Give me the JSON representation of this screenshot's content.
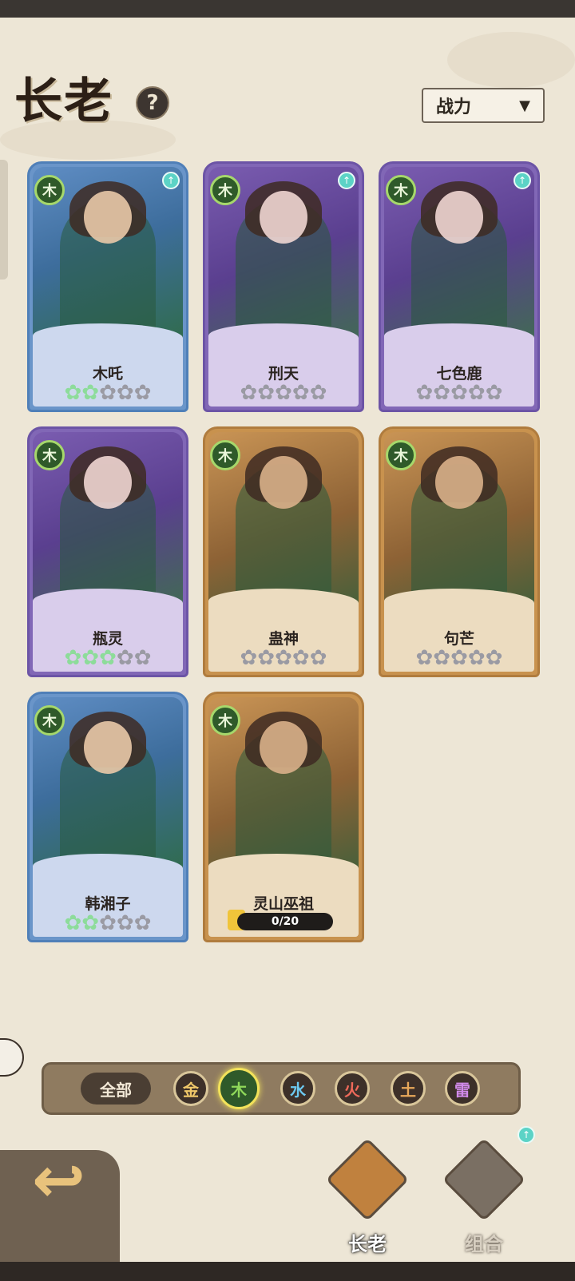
{
  "header": {
    "title": "长老",
    "help_icon": "?",
    "sort_label": "战力"
  },
  "cards": [
    {
      "name": "木吒",
      "element": "木",
      "frame": "blue",
      "stars_filled": 2,
      "stars_total": 5,
      "upgrade": true
    },
    {
      "name": "刑天",
      "element": "木",
      "frame": "purple",
      "stars_filled": 0,
      "stars_total": 5,
      "upgrade": true
    },
    {
      "name": "七色鹿",
      "element": "木",
      "frame": "purple",
      "stars_filled": 0,
      "stars_total": 5,
      "upgrade": true
    },
    {
      "name": "瓶灵",
      "element": "木",
      "frame": "purple",
      "stars_filled": 3,
      "stars_total": 5,
      "upgrade": false
    },
    {
      "name": "蛊神",
      "element": "木",
      "frame": "gold",
      "stars_filled": 0,
      "stars_total": 5,
      "upgrade": false
    },
    {
      "name": "句芒",
      "element": "木",
      "frame": "gold",
      "stars_filled": 0,
      "stars_total": 5,
      "upgrade": false
    },
    {
      "name": "韩湘子",
      "element": "木",
      "frame": "blue",
      "stars_filled": 2,
      "stars_total": 5,
      "upgrade": false
    },
    {
      "name": "灵山巫祖",
      "element": "木",
      "frame": "gold",
      "stars_filled": 0,
      "stars_total": 0,
      "upgrade": false,
      "progress": "0/20"
    }
  ],
  "filters": {
    "all_label": "全部",
    "elements": [
      {
        "label": "金",
        "color": "#f0c86a",
        "active": false
      },
      {
        "label": "木",
        "color": "#8fd85a",
        "active": true
      },
      {
        "label": "水",
        "color": "#6cc8f0",
        "active": false
      },
      {
        "label": "火",
        "color": "#f06a5a",
        "active": false
      },
      {
        "label": "土",
        "color": "#e8a85a",
        "active": false
      },
      {
        "label": "雷",
        "color": "#d08ae8",
        "active": false
      }
    ]
  },
  "nav": {
    "elder_label": "长老",
    "combo_label": "组合",
    "upgrade_badge": "↑"
  },
  "colors": {
    "background": "#ede6d6",
    "star_active": "#8ddc9a",
    "star_inactive": "#9a9aa3"
  }
}
